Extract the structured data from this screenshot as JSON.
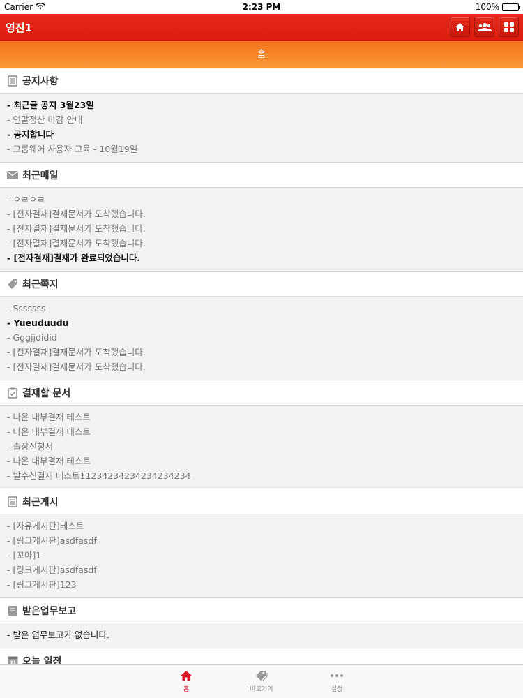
{
  "status": {
    "carrier": "Carrier",
    "time": "2:23 PM",
    "battery": "100%"
  },
  "header": {
    "title": "영진1"
  },
  "home_bar": {
    "label": "홈"
  },
  "sections": {
    "notice": {
      "title": "공지사항",
      "items": [
        "- 최근글 공지 3월23일",
        "- 연말정산 마감 안내",
        "- 공지합니다",
        "- 그룹웨어 사용자 교육 - 10월19일"
      ]
    },
    "mail": {
      "title": "최근메일",
      "items": [
        "- ㅇㄹㅇㄹ",
        "- [전자결재]결재문서가 도착했습니다.",
        "- [전자결재]결재문서가 도착했습니다.",
        "- [전자결재]결재문서가 도착했습니다.",
        "- [전자결재]결재가 완료되었습니다."
      ]
    },
    "memo": {
      "title": "최근쪽지",
      "items": [
        "- Sssssss",
        "- Yueuduudu",
        "- Gggjjdidid",
        "- [전자결재]결재문서가 도착했습니다.",
        "- [전자결재]결재문서가 도착했습니다."
      ]
    },
    "approval": {
      "title": "결재할 문서",
      "items": [
        "- 나온 내부결재 테스트",
        "- 나온 내부결재 테스트",
        "- 출장신청서",
        "- 나온 내부결재 테스트",
        "- 발수신결재 테스트11234234234234234234"
      ]
    },
    "board": {
      "title": "최근게시",
      "items": [
        "- [자유게시판]테스트",
        "- [링크게시판]asdfasdf",
        "- [꼬아]1",
        "- [링크게시판]asdfasdf",
        "- [링크게시판]123"
      ]
    },
    "report": {
      "title": "받은업무보고",
      "items": [
        "- 받은 업무보고가 없습니다."
      ]
    },
    "schedule": {
      "title": "오늘 일정",
      "icon_day": "31"
    }
  },
  "tabs": {
    "home": "홈",
    "shortcut": "바로가기",
    "settings": "설정"
  },
  "colors": {
    "header_red": "#d91c0c",
    "home_bar_orange": "#f7841f",
    "tab_active": "#d8172a"
  }
}
